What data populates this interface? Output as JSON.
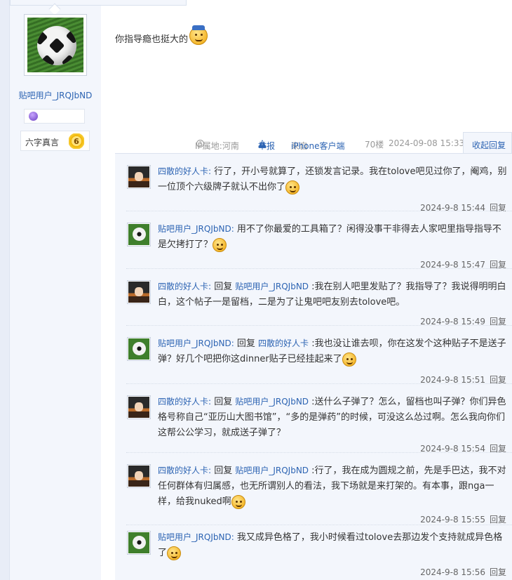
{
  "author": {
    "username": "贴吧用户_JRQJbND",
    "motto_label": "六字真言",
    "motto_level": "6"
  },
  "post": {
    "text": "你指导瘾也挺大的",
    "ip_location": "IP属地:河南",
    "report_label": "举报",
    "client": "来自iPhone客户端",
    "floor": "70楼",
    "datetime": "2024-09-08 15:33",
    "collapse_label": "收起回复"
  },
  "replies": [
    {
      "avatar": "anime",
      "user": "四散的好人卡:",
      "reply_to": "",
      "text": " 行了，开小号就算了，还锁发言记录。我在tolove吧见过你了，阉鸡，别一位顶个六级牌子就认不出你了",
      "emoji": "sweat-smile",
      "time": "2024-9-8 15:44",
      "reply_label": "回复"
    },
    {
      "avatar": "ball",
      "user": "贴吧用户_JRQJbND:",
      "reply_to": "",
      "text": " 用不了你最爱的工具箱了？闲得没事干非得去人家吧里指导指导不是欠拷打了？",
      "emoji": "laugh",
      "time": "2024-9-8 15:47",
      "reply_label": "回复"
    },
    {
      "avatar": "anime",
      "user": "四散的好人卡:",
      "reply_to": "贴吧用户_JRQJbND",
      "text": " :我在别人吧里发贴了？我指导了？我说得明明白白，这个帖子一是留档，二是为了让鬼吧吧友别去tolove吧。",
      "emoji": "",
      "time": "2024-9-8 15:49",
      "reply_label": "回复"
    },
    {
      "avatar": "ball",
      "user": "贴吧用户_JRQJbND:",
      "reply_to": "四散的好人卡",
      "text": " :我也没让谁去呗，你在这发个这种贴子不是送子弹？好几个吧把你这dinner贴子已经挂起来了",
      "emoji": "angry",
      "time": "2024-9-8 15:51",
      "reply_label": "回复"
    },
    {
      "avatar": "anime",
      "user": "四散的好人卡:",
      "reply_to": "贴吧用户_JRQJbND",
      "text": " :送什么子弹了？怎么，留档也叫子弹？你们异色格号称自己“亚历山大图书馆”，“多的是弹药”的时候，可没这么怂过啊。怎么我向你们这帮公公学习，就成送子弹了？",
      "emoji": "",
      "time": "2024-9-8 15:54",
      "reply_label": "回复"
    },
    {
      "avatar": "anime",
      "user": "四散的好人卡:",
      "reply_to": "贴吧用户_JRQJbND",
      "text": " :行了，我在成为圆规之前，先是手巴达，我不对任何群体有归属感，也无所谓别人的看法，我下场就是来打架的。有本事，跟nga一样，给我nuked啊",
      "emoji": "smile",
      "time": "2024-9-8 15:55",
      "reply_label": "回复"
    },
    {
      "avatar": "ball",
      "user": "贴吧用户_JRQJbND:",
      "reply_to": "",
      "text": " 我又成异色格了，我小时候看过tolove去那边发个支持就成异色格了",
      "emoji": "shock",
      "time": "2024-9-8 15:56",
      "reply_label": "回复"
    }
  ],
  "reply_prefix": "回复"
}
